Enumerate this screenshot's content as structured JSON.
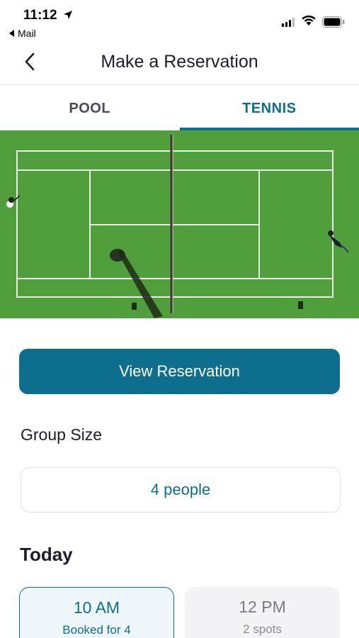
{
  "status_bar": {
    "time": "11:12",
    "back_app": "Mail"
  },
  "header": {
    "title": "Make a Reservation"
  },
  "tabs": [
    {
      "label": "POOL",
      "active": false
    },
    {
      "label": "TENNIS",
      "active": true
    }
  ],
  "actions": {
    "view_reservation": "View Reservation"
  },
  "group_size": {
    "label": "Group Size",
    "value": "4 people"
  },
  "schedule": {
    "day_label": "Today",
    "slots": [
      {
        "time": "10 AM",
        "detail": "Booked for 4",
        "selected": true
      },
      {
        "time": "12 PM",
        "detail": "2 spots",
        "selected": false
      }
    ]
  },
  "colors": {
    "accent": "#0d6e8e",
    "court_green": "#4e9a3a"
  }
}
